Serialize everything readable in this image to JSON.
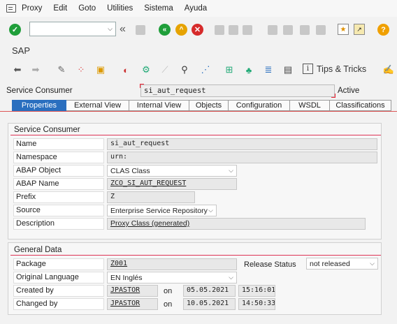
{
  "menu": {
    "items": [
      {
        "label": "Proxy"
      },
      {
        "label": "Edit"
      },
      {
        "label": "Goto"
      },
      {
        "label": "Utilities"
      },
      {
        "label": "Sistema"
      },
      {
        "label": "Ayuda"
      }
    ]
  },
  "toolbar": {
    "command_field_value": "",
    "icons": [
      "check-icon",
      "back-double-icon",
      "save-icon",
      "back-icon",
      "exit-icon",
      "cancel-icon",
      "print-icon",
      "find-icon",
      "find-next-icon",
      "first-page-icon",
      "prev-page-icon",
      "next-page-icon",
      "last-page-icon",
      "new-session-icon",
      "shortcut-icon",
      "help-icon"
    ]
  },
  "app": {
    "title": "SAP"
  },
  "toolbar2": {
    "tips_label": "Tips & Tricks"
  },
  "header": {
    "label": "Service Consumer",
    "value": "si_aut_request",
    "status": "Active"
  },
  "tabs": [
    {
      "label": "Properties",
      "active": true
    },
    {
      "label": "External View"
    },
    {
      "label": "Internal View"
    },
    {
      "label": "Objects"
    },
    {
      "label": "Configuration"
    },
    {
      "label": "WSDL"
    },
    {
      "label": "Classifications"
    }
  ],
  "service_consumer": {
    "title": "Service Consumer",
    "rows": [
      {
        "label": "Name",
        "value": "si_aut_request"
      },
      {
        "label": "Namespace",
        "value": "urn:"
      },
      {
        "label": "ABAP Object",
        "value": "CLAS Class"
      },
      {
        "label": "ABAP Name",
        "value": "ZCO_SI_AUT_REQUEST"
      },
      {
        "label": "Prefix",
        "value": "Z"
      },
      {
        "label": "Source",
        "value": "Enterprise Service Repository"
      },
      {
        "label": "Description",
        "value": "Proxy Class (generated)"
      }
    ]
  },
  "general_data": {
    "title": "General Data",
    "package": {
      "label": "Package",
      "value": "Z001"
    },
    "release_status": {
      "label": "Release Status",
      "value": "not released"
    },
    "original_language": {
      "label": "Original Language",
      "value": "EN Inglés"
    },
    "created_by": {
      "label": "Created by",
      "user": "JPASTOR",
      "on_label": "on",
      "date": "05.05.2021",
      "time": "15:16:01"
    },
    "changed_by": {
      "label": "Changed by",
      "user": "JPASTOR",
      "on_label": "on",
      "date": "10.05.2021",
      "time": "14:50:33"
    }
  },
  "colors": {
    "accent": "#2a6fbf",
    "rule": "#d33355",
    "ok_green": "#1f9e3a",
    "cancel_red": "#d62b2b",
    "help_orange": "#f0a000"
  }
}
